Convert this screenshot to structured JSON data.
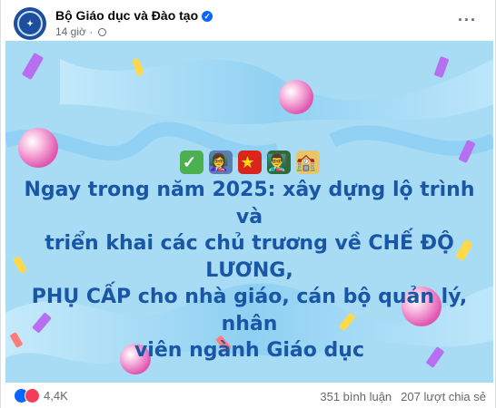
{
  "post": {
    "page_name": "Bộ Giáo dục và Đào tạo",
    "time": "14 giờ",
    "headline_lines": [
      "Ngay trong năm 2025: xây dựng lộ trình và",
      "triển khai các chủ trương về CHẾ ĐỘ LƯƠNG,",
      "PHỤ CẤP cho nhà giáo, cán bộ quản lý, nhân",
      "viên ngành Giáo dục"
    ],
    "emojis": [
      "✓",
      "👩‍🏫",
      "★",
      "👨‍🏫",
      "🏫"
    ]
  },
  "footer": {
    "reaction_count": "4,4K",
    "comments": "351 bình luận",
    "shares": "207 lượt chia sẻ"
  },
  "colors": {
    "headline": "#1a56a6",
    "background": "#a8dcf5",
    "accent": "#0866ff"
  }
}
